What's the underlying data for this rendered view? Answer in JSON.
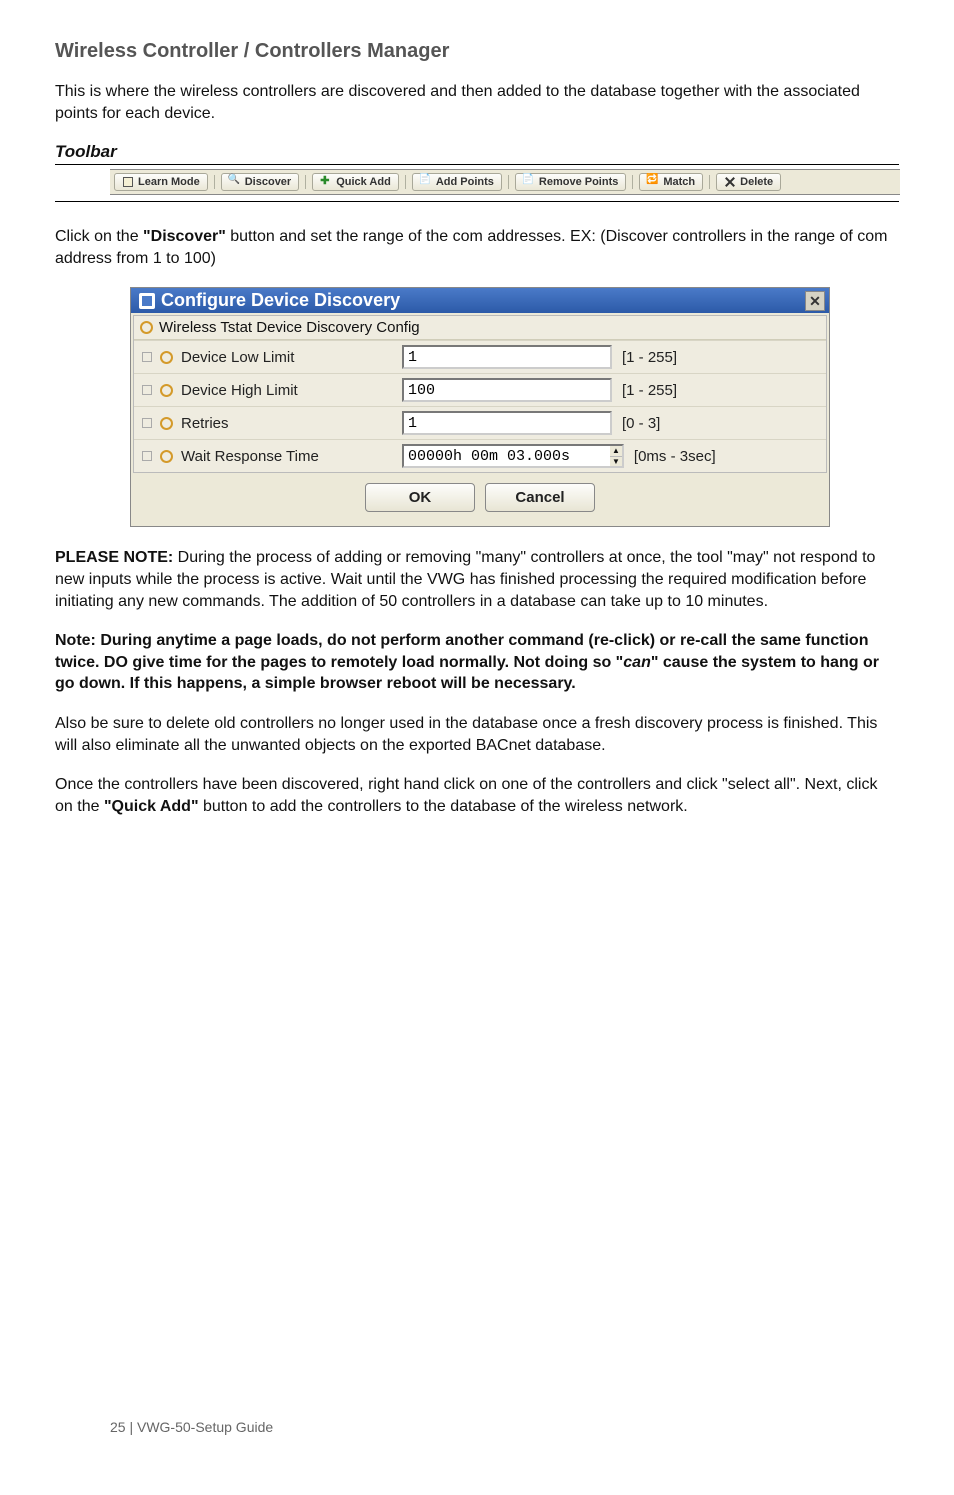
{
  "section_heading": "Wireless Controller / Controllers Manager",
  "intro_para": "This is where the wireless controllers are discovered and then added to the database together with the associated points for each device.",
  "toolbar_heading": "Toolbar",
  "toolbar": {
    "learn": "Learn Mode",
    "discover": "Discover",
    "quick_add": "Quick Add",
    "add_points": "Add Points",
    "remove_points": "Remove Points",
    "match": "Match",
    "delete": "Delete"
  },
  "discover_para_pre": "Click on the ",
  "discover_para_bold": "\"Discover\"",
  "discover_para_post": " button and set the range of the com addresses. EX: (Discover controllers in the range of com address from 1 to 100)",
  "dialog": {
    "title": "Configure Device Discovery",
    "group_title": "Wireless Tstat Device Discovery Config",
    "rows": {
      "low": {
        "label": "Device Low Limit",
        "value": "1",
        "range": "[1 - 255]"
      },
      "high": {
        "label": "Device High Limit",
        "value": "100",
        "range": "[1 - 255]"
      },
      "retry": {
        "label": "Retries",
        "value": "1",
        "range": "[0 - 3]"
      },
      "wait": {
        "label": "Wait Response Time",
        "value": "00000h 00m 03.000s",
        "range": "[0ms - 3sec]"
      }
    },
    "ok": "OK",
    "cancel": "Cancel"
  },
  "please_note_label": "PLEASE NOTE:",
  "please_note_body": " During the process of adding or removing \"many\" controllers at once, the tool \"may\" not respond to new inputs while the process is active. Wait until the VWG has finished processing the required modification before initiating any new commands. The addition of 50 controllers in a database can take up to 10 minutes.",
  "note_bold_pre": "Note: During anytime a page loads, do not perform another command (re-click) or re-call the same function twice. DO give time for the pages to remotely load normally. Not doing so \"",
  "note_bold_italic": "can",
  "note_bold_post": "\" cause the system to hang or go down. If this happens, a simple browser reboot will be necessary.",
  "also_para": "Also be sure to delete old controllers no longer used in the database once a fresh discovery process is finished. This will also eliminate all the unwanted objects on the exported BACnet database.",
  "once_para_pre": "Once the controllers have been discovered, right hand click on one of the controllers and click \"select all\". Next, click on the ",
  "once_para_bold": "\"Quick Add\"",
  "once_para_post": " button to add the controllers to the database of the wireless network.",
  "footer": "25 | VWG-50-Setup Guide"
}
